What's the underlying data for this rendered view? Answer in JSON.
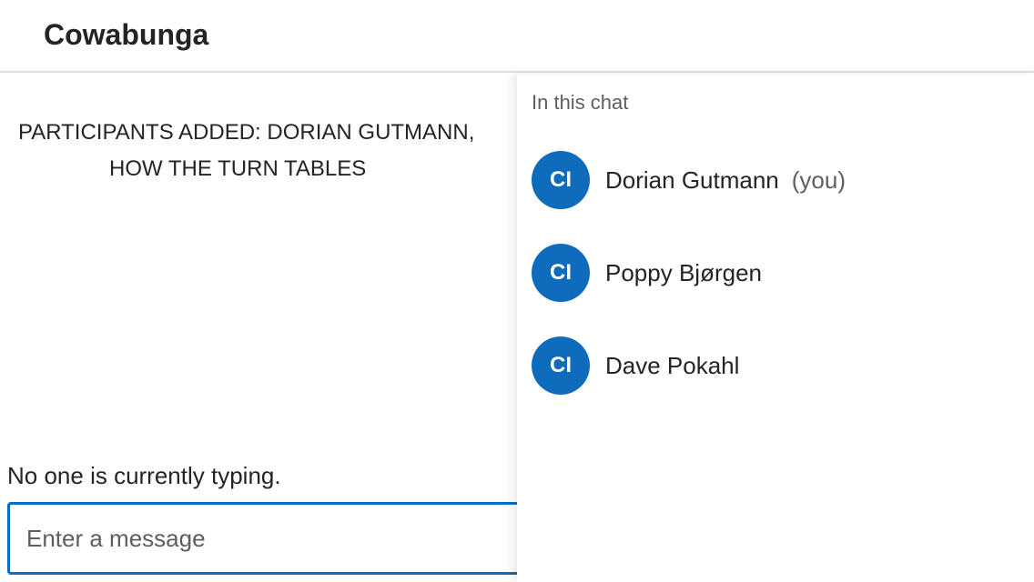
{
  "header": {
    "title": "Cowabunga"
  },
  "messages": {
    "system_line1": "PARTICIPANTS ADDED: DORIAN GUTMANN,",
    "system_line2": "HOW THE TURN TABLES"
  },
  "typing": {
    "status": "No one is currently typing."
  },
  "composer": {
    "placeholder": "Enter a message",
    "value": ""
  },
  "people_panel": {
    "heading": "In this chat",
    "participants": [
      {
        "initials": "CI",
        "name": "Dorian Gutmann",
        "suffix": "(you)"
      },
      {
        "initials": "CI",
        "name": "Poppy Bjørgen",
        "suffix": ""
      },
      {
        "initials": "CI",
        "name": "Dave Pokahl",
        "suffix": ""
      }
    ]
  },
  "colors": {
    "accent": "#0f6cbd",
    "text": "#252423",
    "muted_text": "#605e5c",
    "divider": "#e1dfdd"
  }
}
